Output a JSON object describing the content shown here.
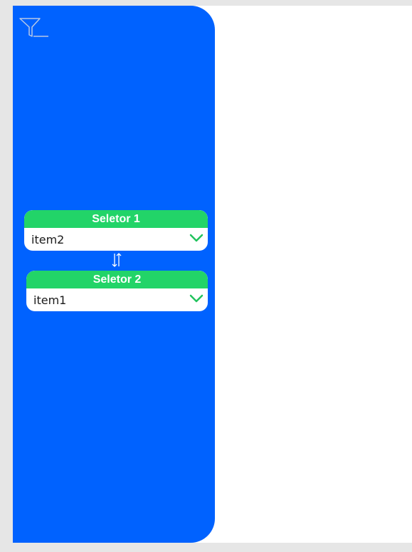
{
  "icons": {
    "filter": "filter-icon",
    "swap": "swap-vertical-icon",
    "dropdown": "chevron-down-icon"
  },
  "colors": {
    "panel": "#0062ff",
    "header": "#22d468",
    "chevron": "#22c35e",
    "canvas": "#ffffff",
    "background": "#e6e6e6"
  },
  "selectors": [
    {
      "title": "Seletor 1",
      "value": "item2"
    },
    {
      "title": "Seletor 2",
      "value": "item1"
    }
  ]
}
